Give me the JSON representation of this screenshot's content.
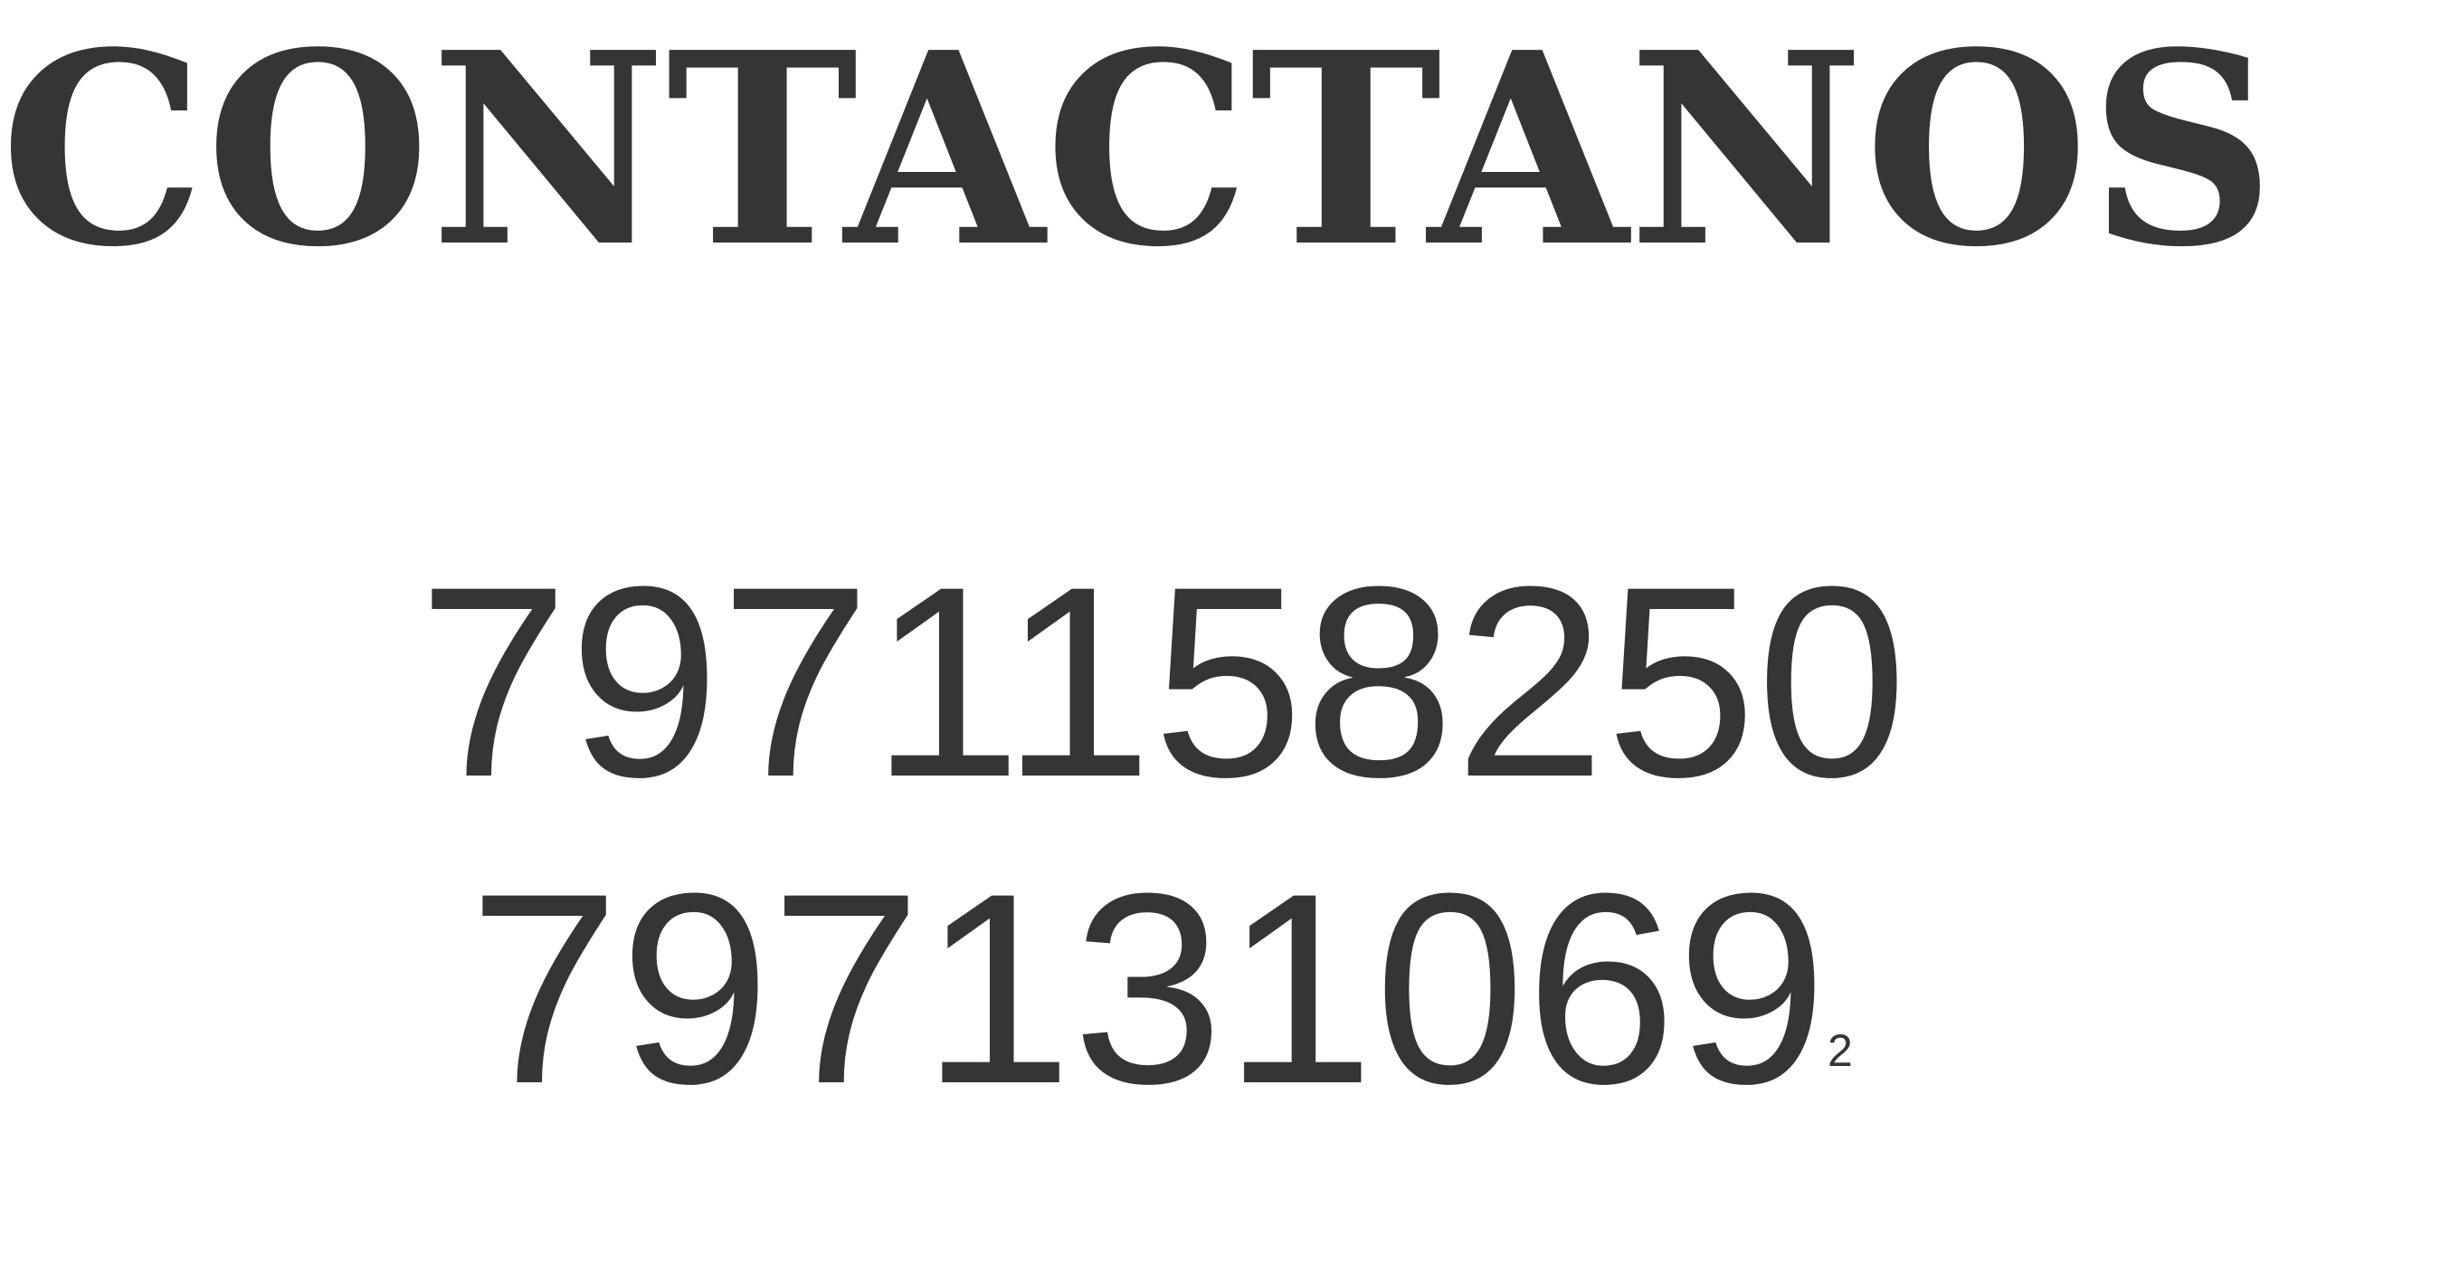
{
  "heading": {
    "text": "CONTACTANOS"
  },
  "phones": [
    "7971158250",
    "797131069"
  ],
  "marker": "2",
  "colors": {
    "text": "#363435",
    "background": "#ffffff"
  }
}
